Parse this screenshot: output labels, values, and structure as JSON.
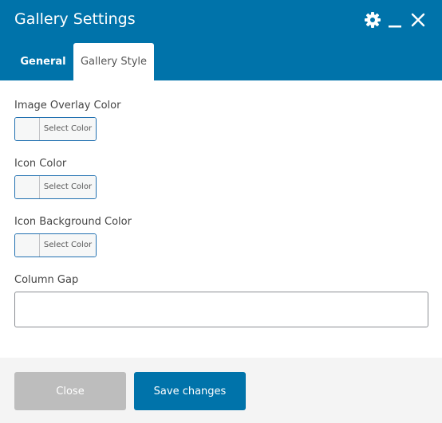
{
  "header": {
    "title": "Gallery Settings",
    "icons": [
      "gear-icon",
      "minimize-icon",
      "close-icon"
    ],
    "bg_color": "#0073aa"
  },
  "tabs": [
    {
      "label": "General",
      "active": false
    },
    {
      "label": "Gallery Style",
      "active": true
    }
  ],
  "fields": {
    "overlay_color": {
      "label": "Image Overlay Color",
      "button": "Select Color"
    },
    "icon_color": {
      "label": "Icon Color",
      "button": "Select Color"
    },
    "icon_bg_color": {
      "label": "Icon Background Color",
      "button": "Select Color"
    },
    "column_gap": {
      "label": "Column Gap",
      "value": ""
    }
  },
  "footer": {
    "close_label": "Close",
    "save_label": "Save changes",
    "save_color": "#0073aa",
    "close_color": "#bdbdbd"
  }
}
